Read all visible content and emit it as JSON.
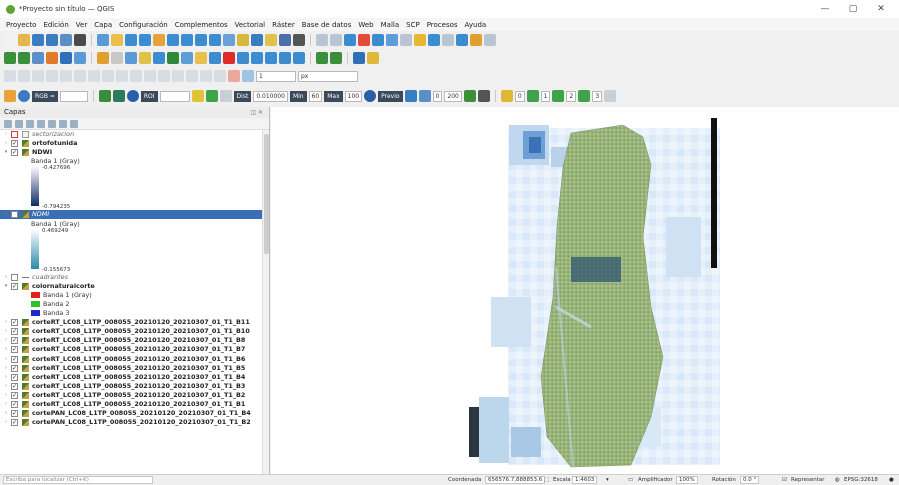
{
  "window": {
    "title": "*Proyecto sin título — QGIS"
  },
  "menu": [
    "Proyecto",
    "Edición",
    "Ver",
    "Capa",
    "Configuración",
    "Complementos",
    "Vectorial",
    "Ráster",
    "Base de datos",
    "Web",
    "Malla",
    "SCP",
    "Procesos",
    "Ayuda"
  ],
  "toolbar": {
    "scale_value": "1",
    "px_unit": "px",
    "rgb_label": "RGB =",
    "roi_label": "ROI",
    "dist_label": "Dist",
    "dist_value": "0.010000",
    "min_label": "Min",
    "min_value": "60",
    "max_label": "Max",
    "max_value": "100",
    "preview_label": "Previo",
    "t_value": "0",
    "scp_value": "200",
    "n1": "0",
    "n2": "1",
    "n3": "2",
    "n4": "3"
  },
  "layers_panel": {
    "title": "Capas",
    "layers": [
      {
        "name": "sectorizacion",
        "kind": "vector",
        "checked": false,
        "style": "italic"
      },
      {
        "name": "ortofotunida",
        "kind": "raster",
        "checked": true,
        "style": "bold"
      },
      {
        "name": "NDWI",
        "kind": "raster",
        "checked": true,
        "style": "bold",
        "band": "Banda 1 (Gray)",
        "max": "-0.427696",
        "min": "-0.794235"
      },
      {
        "name": "NDMI",
        "kind": "raster",
        "checked": false,
        "style": "italic",
        "selected": true,
        "band": "Banda 1 (Gray)",
        "max": "0.469249",
        "min": "-0.155673"
      },
      {
        "name": "cuadrantes",
        "kind": "line",
        "checked": false,
        "style": "italic"
      },
      {
        "name": "colornaturalcorte",
        "kind": "raster",
        "checked": true,
        "style": "bold",
        "bands": [
          "Banda 1 (Gray)",
          "Banda 2",
          "Banda 3"
        ]
      },
      {
        "name": "corteRT_LC08_L1TP_008055_20210120_20210307_01_T1_B11",
        "kind": "raster",
        "checked": true,
        "style": "bold"
      },
      {
        "name": "corteRT_LC08_L1TP_008055_20210120_20210307_01_T1_B10",
        "kind": "raster",
        "checked": true,
        "style": "bold"
      },
      {
        "name": "corteRT_LC08_L1TP_008055_20210120_20210307_01_T1_B8",
        "kind": "raster",
        "checked": true,
        "style": "bold"
      },
      {
        "name": "corteRT_LC08_L1TP_008055_20210120_20210307_01_T1_B7",
        "kind": "raster",
        "checked": true,
        "style": "bold"
      },
      {
        "name": "corteRT_LC08_L1TP_008055_20210120_20210307_01_T1_B6",
        "kind": "raster",
        "checked": true,
        "style": "bold"
      },
      {
        "name": "corteRT_LC08_L1TP_008055_20210120_20210307_01_T1_B5",
        "kind": "raster",
        "checked": true,
        "style": "bold"
      },
      {
        "name": "corteRT_LC08_L1TP_008055_20210120_20210307_01_T1_B4",
        "kind": "raster",
        "checked": true,
        "style": "bold"
      },
      {
        "name": "corteRT_LC08_L1TP_008055_20210120_20210307_01_T1_B3",
        "kind": "raster",
        "checked": true,
        "style": "bold"
      },
      {
        "name": "corteRT_LC08_L1TP_008055_20210120_20210307_01_T1_B2",
        "kind": "raster",
        "checked": true,
        "style": "bold"
      },
      {
        "name": "corteRT_LC08_L1TP_008055_20210120_20210307_01_T1_B1",
        "kind": "raster",
        "checked": true,
        "style": "bold"
      },
      {
        "name": "cortePAN_LC08_L1TP_008055_20210120_20210307_01_T1_B4",
        "kind": "raster",
        "checked": true,
        "style": "bold"
      },
      {
        "name": "cortePAN_LC08_L1TP_008055_20210120_20210307_01_T1_B2",
        "kind": "raster",
        "checked": true,
        "style": "bold"
      }
    ]
  },
  "statusbar": {
    "locator_placeholder": "Escriba para localizar (Ctrl+K)",
    "coord_label": "Coordenada",
    "coord_value": "656576.7,888853.6",
    "scale_label": "Escala",
    "scale_value": "1:4603",
    "magnifier_label": "Amplificador",
    "magnifier_value": "100%",
    "rotation_label": "Rotación",
    "rotation_value": "0.0 °",
    "render_label": "Representar",
    "crs": "EPSG:32618"
  },
  "colors": {
    "selection": "#3a6fb5",
    "ndwi_dark": "#0e2b66",
    "ndmi_light": "#2a8aa8",
    "band1": "#e02020",
    "band2": "#2cc22c",
    "band3": "#2228c8"
  }
}
